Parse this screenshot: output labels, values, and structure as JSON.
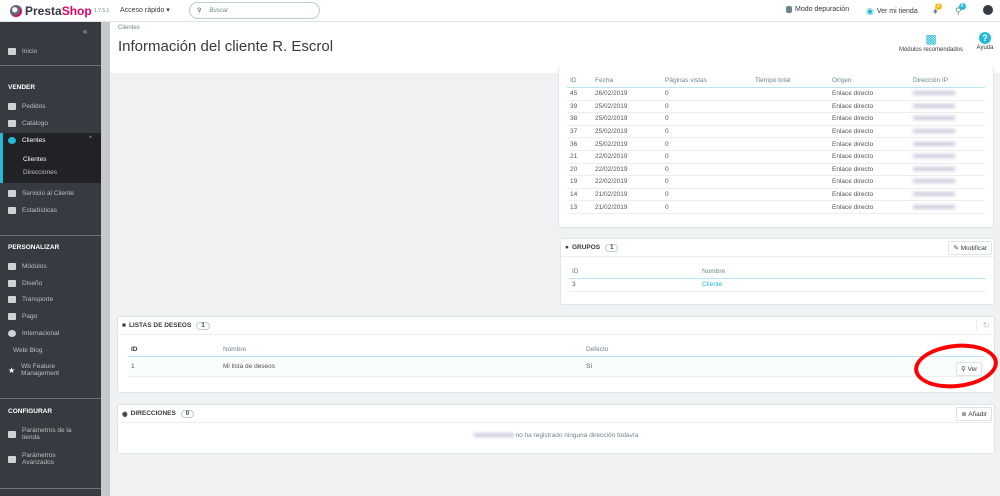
{
  "topbar": {
    "brand_a": "Presta",
    "brand_b": "Shop",
    "version": "1.7.5.1",
    "quick_access": "Acceso rápido ▾",
    "search_placeholder": "Buscar",
    "debug": "Modo depuración",
    "view_store": "Ver mi tienda",
    "notif_orders": "2",
    "notif_customers": "8"
  },
  "sidebar": {
    "home": "Inicio",
    "sections": [
      "VENDER",
      "PERSONALIZAR",
      "CONFIGURAR"
    ],
    "sell": [
      "Pedidos",
      "Catálogo",
      "Clientes"
    ],
    "clientes_sub": [
      "Clientes",
      "Direcciones"
    ],
    "sell2": [
      "Servicio al Cliente",
      "Estadísticas"
    ],
    "improve": [
      "Módulos",
      "Diseño",
      "Transporte",
      "Pago",
      "Internacional"
    ],
    "webi": "Webi Blog",
    "wb1": "Wb Feature",
    "wb2": "Management",
    "config1a": "Parámetros de la",
    "config1b": "tienda",
    "config2a": "Parámetros",
    "config2b": "Avanzados"
  },
  "header": {
    "breadcrumb": "Clientes",
    "title": "Información del cliente R. Escrol",
    "modules": "Módulos recomendados",
    "help": "Ayuda"
  },
  "visits": {
    "columns": [
      "ID",
      "Fecha",
      "Páginas vistas",
      "Tiempo total",
      "Origen",
      "Dirección IP"
    ],
    "rows": [
      [
        "45",
        "26/02/2019",
        "0",
        "",
        "Enlace directo"
      ],
      [
        "39",
        "25/02/2019",
        "0",
        "",
        "Enlace directo"
      ],
      [
        "38",
        "25/02/2019",
        "0",
        "",
        "Enlace directo"
      ],
      [
        "37",
        "25/02/2019",
        "0",
        "",
        "Enlace directo"
      ],
      [
        "36",
        "25/02/2019",
        "0",
        "",
        "Enlace directo"
      ],
      [
        "21",
        "22/02/2019",
        "0",
        "",
        "Enlace directo"
      ],
      [
        "20",
        "22/02/2019",
        "0",
        "",
        "Enlace directo"
      ],
      [
        "19",
        "22/02/2019",
        "0",
        "",
        "Enlace directo"
      ],
      [
        "14",
        "21/02/2019",
        "0",
        "",
        "Enlace directo"
      ],
      [
        "13",
        "21/02/2019",
        "0",
        "",
        "Enlace directo"
      ]
    ]
  },
  "groups": {
    "title": "GRUPOS",
    "count": "1",
    "edit": "Modificar",
    "columns": [
      "ID",
      "Nombre"
    ],
    "rows": [
      [
        "3",
        "Cliente"
      ]
    ]
  },
  "wishlists": {
    "title": "LISTAS DE DESEOS",
    "count": "1",
    "columns": [
      "ID",
      "Nombre",
      "Defecto"
    ],
    "rows": [
      [
        "1",
        "Mi lista de deseos",
        "Sí"
      ]
    ],
    "view": "Ver"
  },
  "addresses": {
    "title": "DIRECCIONES",
    "count": "0",
    "add": "Añadir",
    "empty": "no ha registrado ninguna dirección todavía"
  },
  "colors": {
    "accent": "#25b9d7",
    "brand": "#df0067",
    "sidebar": "#363a41",
    "annotation": "#ff0000"
  }
}
